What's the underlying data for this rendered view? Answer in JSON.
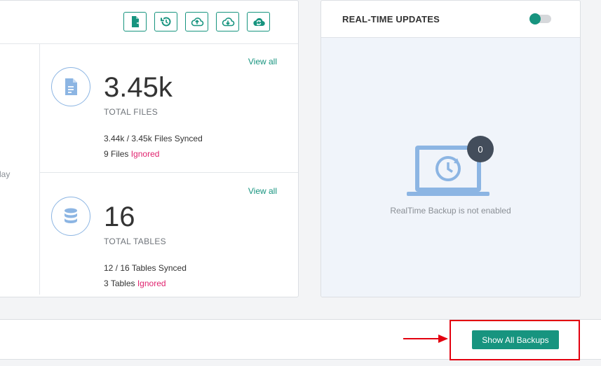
{
  "toolbar": {
    "icons": [
      "export-file-icon",
      "restore-icon",
      "cloud-upload-icon",
      "cloud-download-icon",
      "cloud-sync-icon"
    ],
    "accent": "#17947f"
  },
  "left_panel": {
    "cut_text": "lay",
    "files": {
      "view_all": "View all",
      "count": "3.45k",
      "label": "TOTAL FILES",
      "synced_value": "3.44k / 3.45k",
      "synced_label": "Files Synced",
      "ignored_value": "9",
      "ignored_prefix": "Files",
      "ignored_label": "Ignored"
    },
    "tables": {
      "view_all": "View all",
      "count": "16",
      "label": "TOTAL TABLES",
      "synced_value": "12 / 16",
      "synced_label": "Tables Synced",
      "ignored_value": "3",
      "ignored_prefix": "Tables",
      "ignored_label": "Ignored"
    }
  },
  "realtime": {
    "title": "REAL-TIME UPDATES",
    "toggle_on": true,
    "badge_count": "0",
    "message": "RealTime Backup is not enabled"
  },
  "footer": {
    "show_all_backups": "Show All Backups"
  },
  "colors": {
    "accent": "#17947f",
    "ignored": "#e0236e",
    "icon_blue": "#8cb5e3",
    "highlight_red": "#e3000f"
  }
}
